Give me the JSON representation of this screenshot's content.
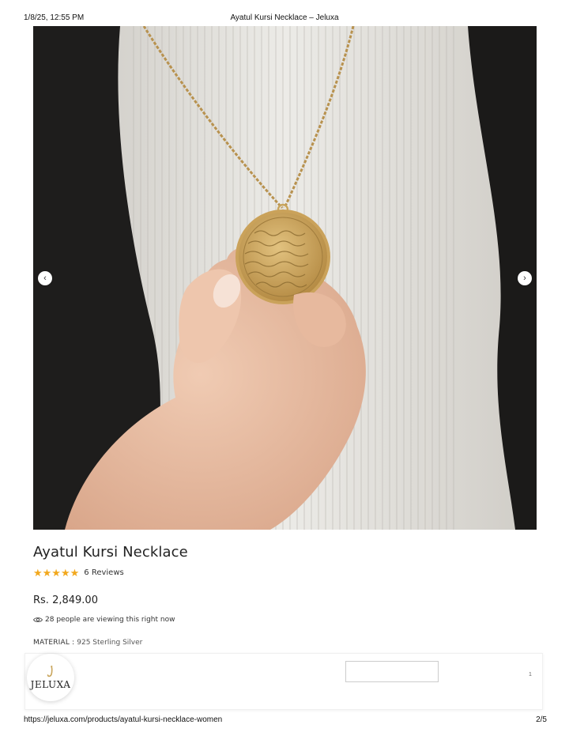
{
  "print_header": {
    "datetime": "1/8/25, 12:55 PM",
    "page_title": "Ayatul Kursi Necklace – Jeluxa"
  },
  "gallery": {
    "prev_icon": "chevron-left-icon",
    "next_icon": "chevron-right-icon",
    "prev_glyph": "‹",
    "next_glyph": "›"
  },
  "product": {
    "title": "Ayatul Kursi Necklace",
    "rating_stars": 5,
    "stars_text": "★★★★★",
    "reviews_text": "6 Reviews",
    "price": "Rs. 2,849.00",
    "viewing_text": "28 people are viewing this right now",
    "material_label": "MATERIAL :",
    "material_value": "925 Sterling Silver"
  },
  "sticky_bar": {
    "logo_text": "JELUXA",
    "number": "1"
  },
  "print_footer": {
    "url": "https://jeluxa.com/products/ayatul-kursi-necklace-women",
    "page": "2/5"
  },
  "colors": {
    "star": "#f2a81d",
    "text": "#222222",
    "gold": "#c9a55c"
  }
}
